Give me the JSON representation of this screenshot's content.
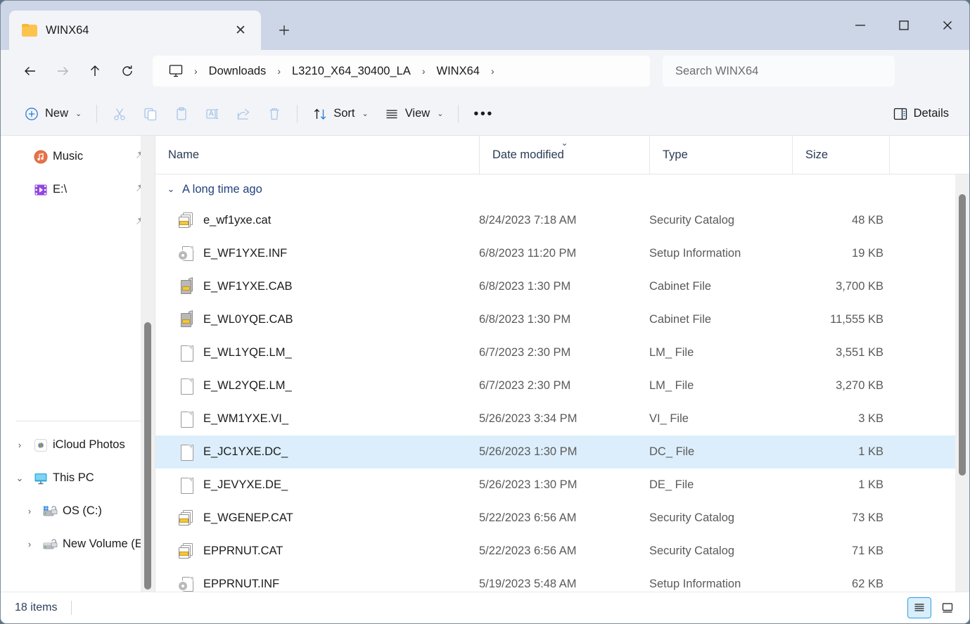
{
  "window": {
    "tab_title": "WINX64",
    "tab_close_glyph": "✕",
    "new_tab_glyph": "＋",
    "minimize_label": "Minimize",
    "maximize_label": "Maximize",
    "close_label": "Close"
  },
  "address": {
    "back_label": "Back",
    "forward_label": "Forward",
    "up_label": "Up",
    "refresh_label": "Refresh",
    "breadcrumbs": [
      "Downloads",
      "L3210_X64_30400_LA",
      "WINX64"
    ],
    "separator": "›",
    "search_placeholder": "Search WINX64",
    "search_value": ""
  },
  "toolbar": {
    "new_label": "New",
    "cut_label": "Cut",
    "copy_label": "Copy",
    "paste_label": "Paste",
    "rename_label": "Rename",
    "share_label": "Share",
    "delete_label": "Delete",
    "sort_label": "Sort",
    "view_label": "View",
    "more_label": "See more",
    "more_glyph": "•••",
    "details_label": "Details",
    "chevron": "⌄"
  },
  "sidebar": {
    "items": [
      {
        "label": "Music",
        "icon": "music-icon",
        "pinned": true,
        "chevron": "",
        "indent": false
      },
      {
        "label": "E:\\",
        "icon": "video-drive-icon",
        "pinned": true,
        "chevron": "",
        "indent": false
      },
      {
        "label": "",
        "icon": "",
        "pinned": true,
        "chevron": "",
        "indent": false
      },
      {
        "label": "iCloud Photos",
        "icon": "icloud-photos-icon",
        "pinned": false,
        "chevron": "›",
        "indent": false
      },
      {
        "label": "This PC",
        "icon": "this-pc-icon",
        "pinned": false,
        "chevron": "⌄",
        "indent": false
      },
      {
        "label": "OS (C:)",
        "icon": "drive-icon",
        "pinned": false,
        "chevron": "›",
        "indent": true
      },
      {
        "label": "New Volume (E",
        "icon": "drive-icon",
        "pinned": false,
        "chevron": "›",
        "indent": true
      }
    ]
  },
  "columns": {
    "name": "Name",
    "date_modified": "Date modified",
    "type": "Type",
    "size": "Size",
    "sort_indicator": "⌄"
  },
  "group": {
    "chevron": "⌄",
    "label": "A long time ago"
  },
  "files": [
    {
      "name": "e_wf1yxe.cat",
      "date": "8/24/2023 7:18 AM",
      "type": "Security Catalog",
      "size": "48 KB",
      "icon": "cat",
      "selected": false
    },
    {
      "name": "E_WF1YXE.INF",
      "date": "6/8/2023 11:20 PM",
      "type": "Setup Information",
      "size": "19 KB",
      "icon": "inf",
      "selected": false
    },
    {
      "name": "E_WF1YXE.CAB",
      "date": "6/8/2023 1:30 PM",
      "type": "Cabinet File",
      "size": "3,700 KB",
      "icon": "cab",
      "selected": false
    },
    {
      "name": "E_WL0YQE.CAB",
      "date": "6/8/2023 1:30 PM",
      "type": "Cabinet File",
      "size": "11,555 KB",
      "icon": "cab",
      "selected": false
    },
    {
      "name": "E_WL1YQE.LM_",
      "date": "6/7/2023 2:30 PM",
      "type": "LM_ File",
      "size": "3,551 KB",
      "icon": "plain",
      "selected": false
    },
    {
      "name": "E_WL2YQE.LM_",
      "date": "6/7/2023 2:30 PM",
      "type": "LM_ File",
      "size": "3,270 KB",
      "icon": "plain",
      "selected": false
    },
    {
      "name": "E_WM1YXE.VI_",
      "date": "5/26/2023 3:34 PM",
      "type": "VI_ File",
      "size": "3 KB",
      "icon": "plain",
      "selected": false
    },
    {
      "name": "E_JC1YXE.DC_",
      "date": "5/26/2023 1:30 PM",
      "type": "DC_ File",
      "size": "1 KB",
      "icon": "plain",
      "selected": true
    },
    {
      "name": "E_JEVYXE.DE_",
      "date": "5/26/2023 1:30 PM",
      "type": "DE_ File",
      "size": "1 KB",
      "icon": "plain",
      "selected": false
    },
    {
      "name": "E_WGENEP.CAT",
      "date": "5/22/2023 6:56 AM",
      "type": "Security Catalog",
      "size": "73 KB",
      "icon": "cat",
      "selected": false
    },
    {
      "name": "EPPRNUT.CAT",
      "date": "5/22/2023 6:56 AM",
      "type": "Security Catalog",
      "size": "71 KB",
      "icon": "cat",
      "selected": false
    },
    {
      "name": "EPPRNUT.INF",
      "date": "5/19/2023 5:48 AM",
      "type": "Setup Information",
      "size": "62 KB",
      "icon": "inf",
      "selected": false
    }
  ],
  "status": {
    "item_count": "18 items",
    "details_view_label": "Details view",
    "large_icons_view_label": "Large icons view"
  },
  "colors": {
    "titlebar": "#cdd6e6",
    "selection": "#dceefb",
    "accent": "#2aa0e6",
    "group_text": "#23427e"
  }
}
